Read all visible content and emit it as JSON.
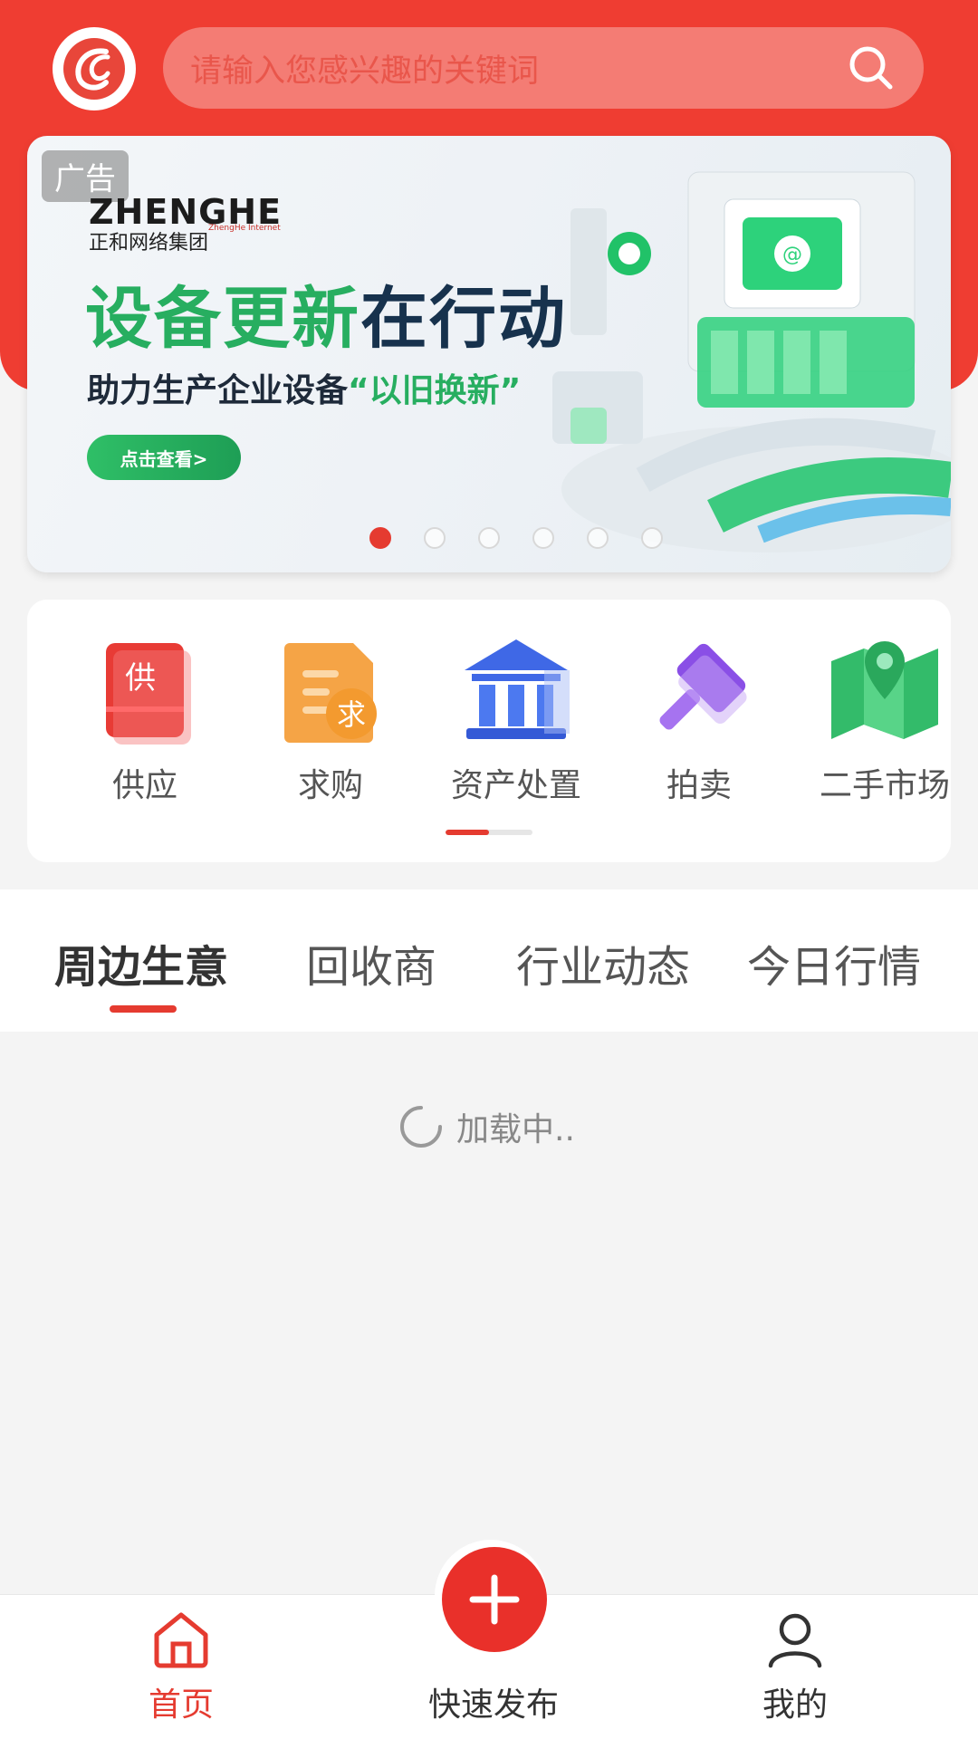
{
  "header": {
    "search_placeholder": "请输入您感兴趣的关键词"
  },
  "banner": {
    "ad_badge": "广告",
    "brand_en": "ZHENGHE",
    "brand_cn": "正和网络集团",
    "brand_sub": "ZhengHe Internet",
    "title_green": "设备更新",
    "title_dark": "在行动",
    "subtitle_prefix": "助力生产企业设备",
    "subtitle_highlight": "“以旧换新”",
    "cta": "点击查看>",
    "slide_count": 6,
    "active_slide": 1
  },
  "categories": [
    {
      "label": "供应",
      "icon": "supply-icon",
      "glyph": "供"
    },
    {
      "label": "求购",
      "icon": "purchase-icon",
      "glyph": "求"
    },
    {
      "label": "资产处置",
      "icon": "asset-disposal-icon"
    },
    {
      "label": "拍卖",
      "icon": "auction-icon"
    },
    {
      "label": "二手市场",
      "icon": "secondhand-market-icon"
    }
  ],
  "tabs": [
    {
      "label": "周边生意",
      "active": true
    },
    {
      "label": "回收商",
      "active": false
    },
    {
      "label": "行业动态",
      "active": false
    },
    {
      "label": "今日行情",
      "active": false
    }
  ],
  "loading": {
    "text": "加载中.."
  },
  "bottom_nav": {
    "home": "首页",
    "publish": "快速发布",
    "mine": "我的"
  },
  "colors": {
    "brand_red": "#ef3d32",
    "accent_red": "#e53b30",
    "banner_green": "#27ae60"
  }
}
